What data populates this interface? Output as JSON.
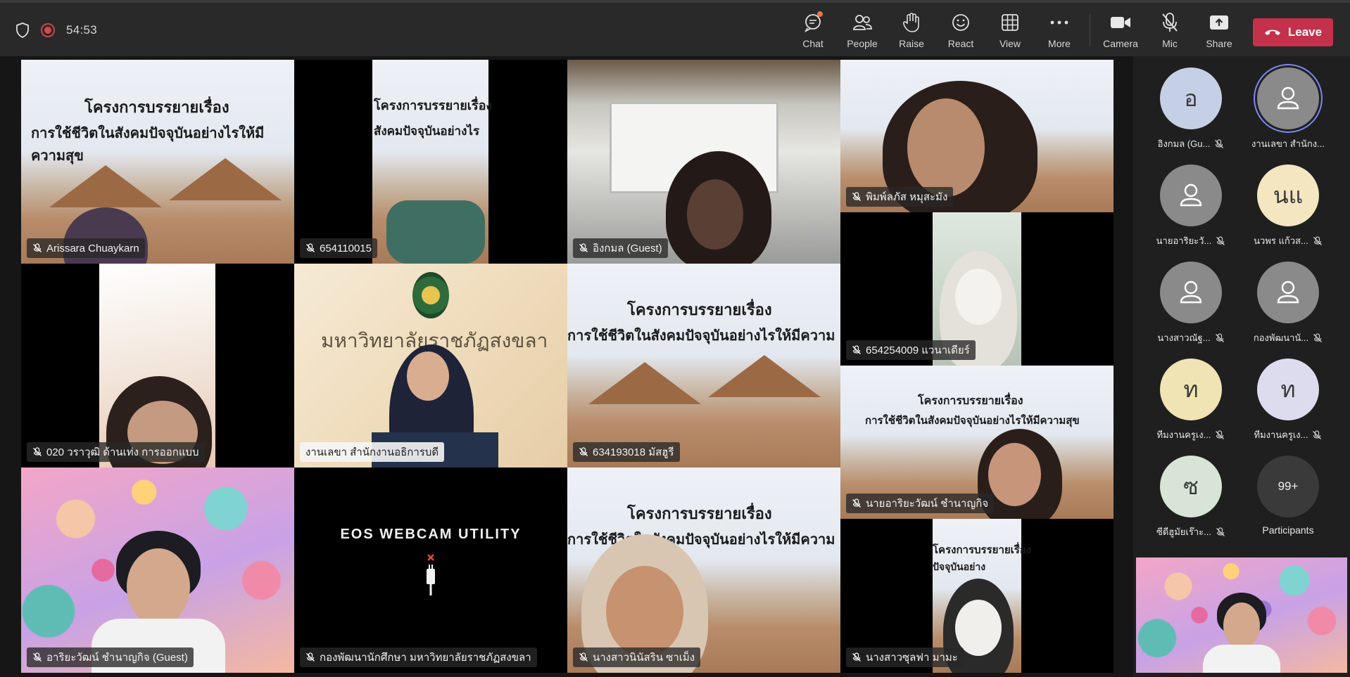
{
  "header": {
    "timer": "54:53",
    "toolbar": [
      {
        "icon": "chat-icon",
        "label": "Chat"
      },
      {
        "icon": "people-icon",
        "label": "People"
      },
      {
        "icon": "raise-hand-icon",
        "label": "Raise"
      },
      {
        "icon": "react-icon",
        "label": "React"
      },
      {
        "icon": "view-icon",
        "label": "View"
      },
      {
        "icon": "more-icon",
        "label": "More"
      },
      {
        "icon": "camera-icon",
        "label": "Camera"
      },
      {
        "icon": "mic-off-icon",
        "label": "Mic"
      },
      {
        "icon": "share-icon",
        "label": "Share"
      }
    ],
    "leave_label": "Leave",
    "colors": {
      "bar": "#292929",
      "leave": "#c4314b",
      "notification": "#e97548"
    }
  },
  "tiles": {
    "t1": {
      "name": "Arissara Chuaykarn",
      "banner_line1": "โครงการบรรยายเรื่อง",
      "banner_line2": "การใช้ชีวิตในสังคมปัจจุบันอย่างไรให้มีความสุข"
    },
    "t2": {
      "name": "654110015",
      "banner_line1": "โครงการบรรยายเรื่อง",
      "banner_line2": "สังคมปัจจุบันอย่างไร"
    },
    "t3": {
      "name": "อิงกมล (Guest)"
    },
    "t4": {
      "name": "พิมพ์ลภัส หมุสะมัง"
    },
    "t5": {
      "name": "020 วราวุฒิ ด้านเท่ง การออกแบบ"
    },
    "t6": {
      "name": "งานเลขา สำนักงานอธิการบดี",
      "backdrop_text": "มหาวิทยาลัยราชภัฏสงขลา"
    },
    "t7": {
      "name": "634193018 มัสฮูรี",
      "banner_line1": "โครงการบรรยายเรื่อง",
      "banner_line2": "การใช้ชีวิตในสังคมปัจจุบันอย่างไรให้มีความ"
    },
    "t8": {
      "name": "654254009 แวนาเดียร์"
    },
    "t9": {
      "name": "นายอาริยะวัฒน์ ชำนาญกิจ",
      "banner_line1": "โครงการบรรยายเรื่อง",
      "banner_line2": "การใช้ชีวิตในสังคมปัจจุบันอย่างไรให้มีความสุข"
    },
    "t10": {
      "name": "อาริยะวัฒน์ ชำนาญกิจ  (Guest)"
    },
    "t11": {
      "name": "กองพัฒนานักศึกษา มหาวิทยาลัยราชภัฏสงขลา",
      "placeholder_text": "EOS WEBCAM UTILITY"
    },
    "t12": {
      "name": "นางสาวนินัสริน ซาเม็ง",
      "banner_line1": "โครงการบรรยายเรื่อง",
      "banner_line2": "การใช้ชีวิตในสังคมปัจจุบันอย่างไรให้มีความ"
    },
    "t13": {
      "name": "นางสาวซุลฟา มามะ",
      "banner_line1": "โครงการบรรยายเรื่อง",
      "banner_line2": "ปัจจุบันอย่าง"
    }
  },
  "participants": {
    "items": [
      {
        "initials": "อ",
        "name": "อิงกมล (Gu...",
        "color": "#c5d0e6"
      },
      {
        "initials": "",
        "name": "งานเลขา สำนักง...",
        "color": "#8a8a8a"
      },
      {
        "initials": "",
        "name": "นายอาริยะวั...",
        "color": "#8a8a8a"
      },
      {
        "initials": "นแ",
        "name": "นวพร แก้วส...",
        "color": "#f3e6c0"
      },
      {
        "initials": "",
        "name": "นางสาวณัฐ...",
        "color": "#8a8a8a"
      },
      {
        "initials": "",
        "name": "กองพัฒนานั...",
        "color": "#8a8a8a"
      },
      {
        "initials": "ท",
        "name": "ทีมงานครูเง...",
        "color": "#f0e4b4"
      },
      {
        "initials": "ท",
        "name": "ทีมงานครูเง...",
        "color": "#dcdcee"
      },
      {
        "initials": "ซ",
        "name": "ซีดีฮูมัยเร๊าะ...",
        "color": "#d8e4d8"
      }
    ],
    "overflow_count": "99+",
    "overflow_label": "Participants"
  }
}
